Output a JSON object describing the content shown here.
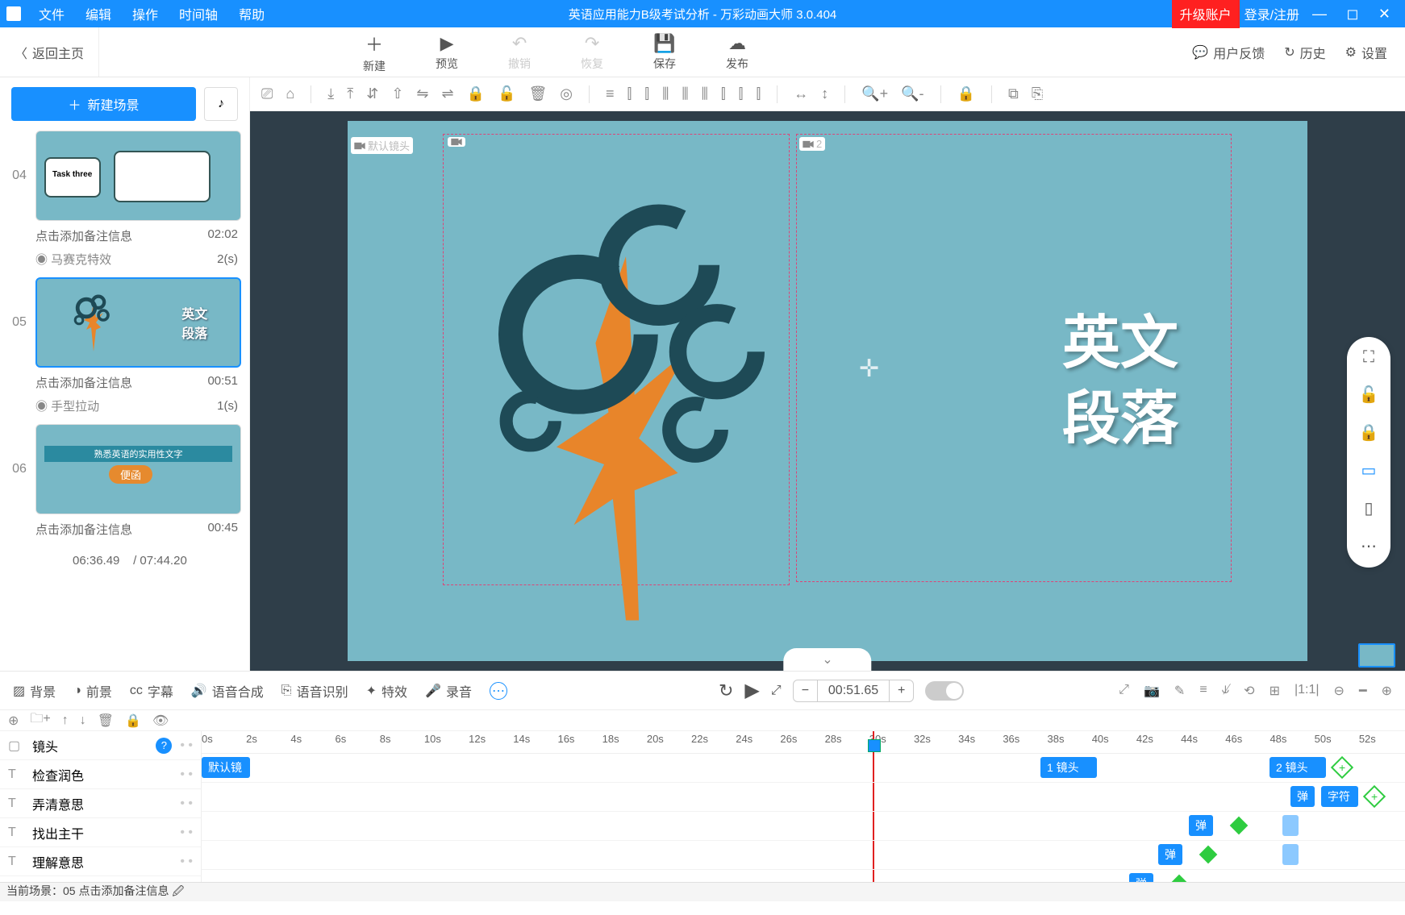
{
  "titlebar": {
    "menus": [
      "文件",
      "编辑",
      "操作",
      "时间轴",
      "帮助"
    ],
    "title": "英语应用能力B级考试分析 - 万彩动画大师 3.0.404",
    "upgrade": "升级账户",
    "login": "登录/注册"
  },
  "toolbar": {
    "back": "返回主页",
    "buttons": [
      {
        "icon": "＋",
        "label": "新建"
      },
      {
        "icon": "▶",
        "label": "预览"
      },
      {
        "icon": "↶",
        "label": "撤销",
        "disabled": true
      },
      {
        "icon": "↷",
        "label": "恢复",
        "disabled": true
      },
      {
        "icon": "💾",
        "label": "保存"
      },
      {
        "icon": "☁",
        "label": "发布"
      }
    ],
    "right": [
      {
        "icon": "💬",
        "label": "用户反馈"
      },
      {
        "icon": "↻",
        "label": "历史"
      },
      {
        "icon": "⚙",
        "label": "设置"
      }
    ]
  },
  "sidebar": {
    "new_scene": "新建场景",
    "scenes": [
      {
        "num": "04",
        "note": "点击添加备注信息",
        "dur": "02:02",
        "trans_name": "马赛克特效",
        "trans_dur": "2(s)"
      },
      {
        "num": "05",
        "note": "点击添加备注信息",
        "dur": "00:51",
        "trans_name": "手型拉动",
        "trans_dur": "1(s)",
        "selected": true,
        "text1": "英文",
        "text2": "段落"
      },
      {
        "num": "06",
        "note": "点击添加备注信息",
        "dur": "00:45",
        "bar_text": "熟悉英语的实用性文字",
        "pill_text": "便函"
      }
    ],
    "time_footer_current": "06:36.49",
    "time_footer_total": "/ 07:44.20"
  },
  "canvas": {
    "cam_default": "默认镜头",
    "cam2_label": "2",
    "big_text_1": "英文",
    "big_text_2": "段落"
  },
  "bottom": {
    "tabs": [
      {
        "icon": "▨",
        "label": "背景"
      },
      {
        "icon": "◑",
        "label": "前景"
      },
      {
        "icon": "cc",
        "label": "字幕"
      },
      {
        "icon": "🔊",
        "label": "语音合成"
      },
      {
        "icon": "⎘",
        "label": "语音识别"
      },
      {
        "icon": "✦",
        "label": "特效"
      },
      {
        "icon": "🎤",
        "label": "录音"
      }
    ],
    "time": "00:51.65",
    "right_icons": [
      "⤢",
      "📷",
      "✎",
      "≡",
      "⫝̸",
      "⟲",
      "⊞",
      "|1:1|",
      "⊖",
      "━",
      "⊕"
    ],
    "tracks": [
      {
        "icon": "▢",
        "label": "镜头",
        "help": true
      },
      {
        "icon": "T",
        "label": "检查润色"
      },
      {
        "icon": "T",
        "label": "弄清意思"
      },
      {
        "icon": "T",
        "label": "找出主干"
      },
      {
        "icon": "T",
        "label": "理解意思"
      }
    ],
    "ruler_ticks": [
      "0s",
      "2s",
      "4s",
      "6s",
      "8s",
      "10s",
      "12s",
      "14s",
      "16s",
      "18s",
      "20s",
      "22s",
      "24s",
      "26s",
      "28s",
      "30s",
      "32s",
      "34s",
      "36s",
      "38s",
      "40s",
      "42s",
      "44s",
      "46s",
      "48s",
      "50s",
      "52s"
    ],
    "clip_default": "默认镜",
    "clip_cam1": "1 镜头",
    "clip_cam2": "2 镜头",
    "small_clip": "弹",
    "small_clip2": "字符",
    "playhead_sec": 30
  },
  "statusbar": {
    "text": "当前场景：05   点击添加备注信息 🖉"
  }
}
